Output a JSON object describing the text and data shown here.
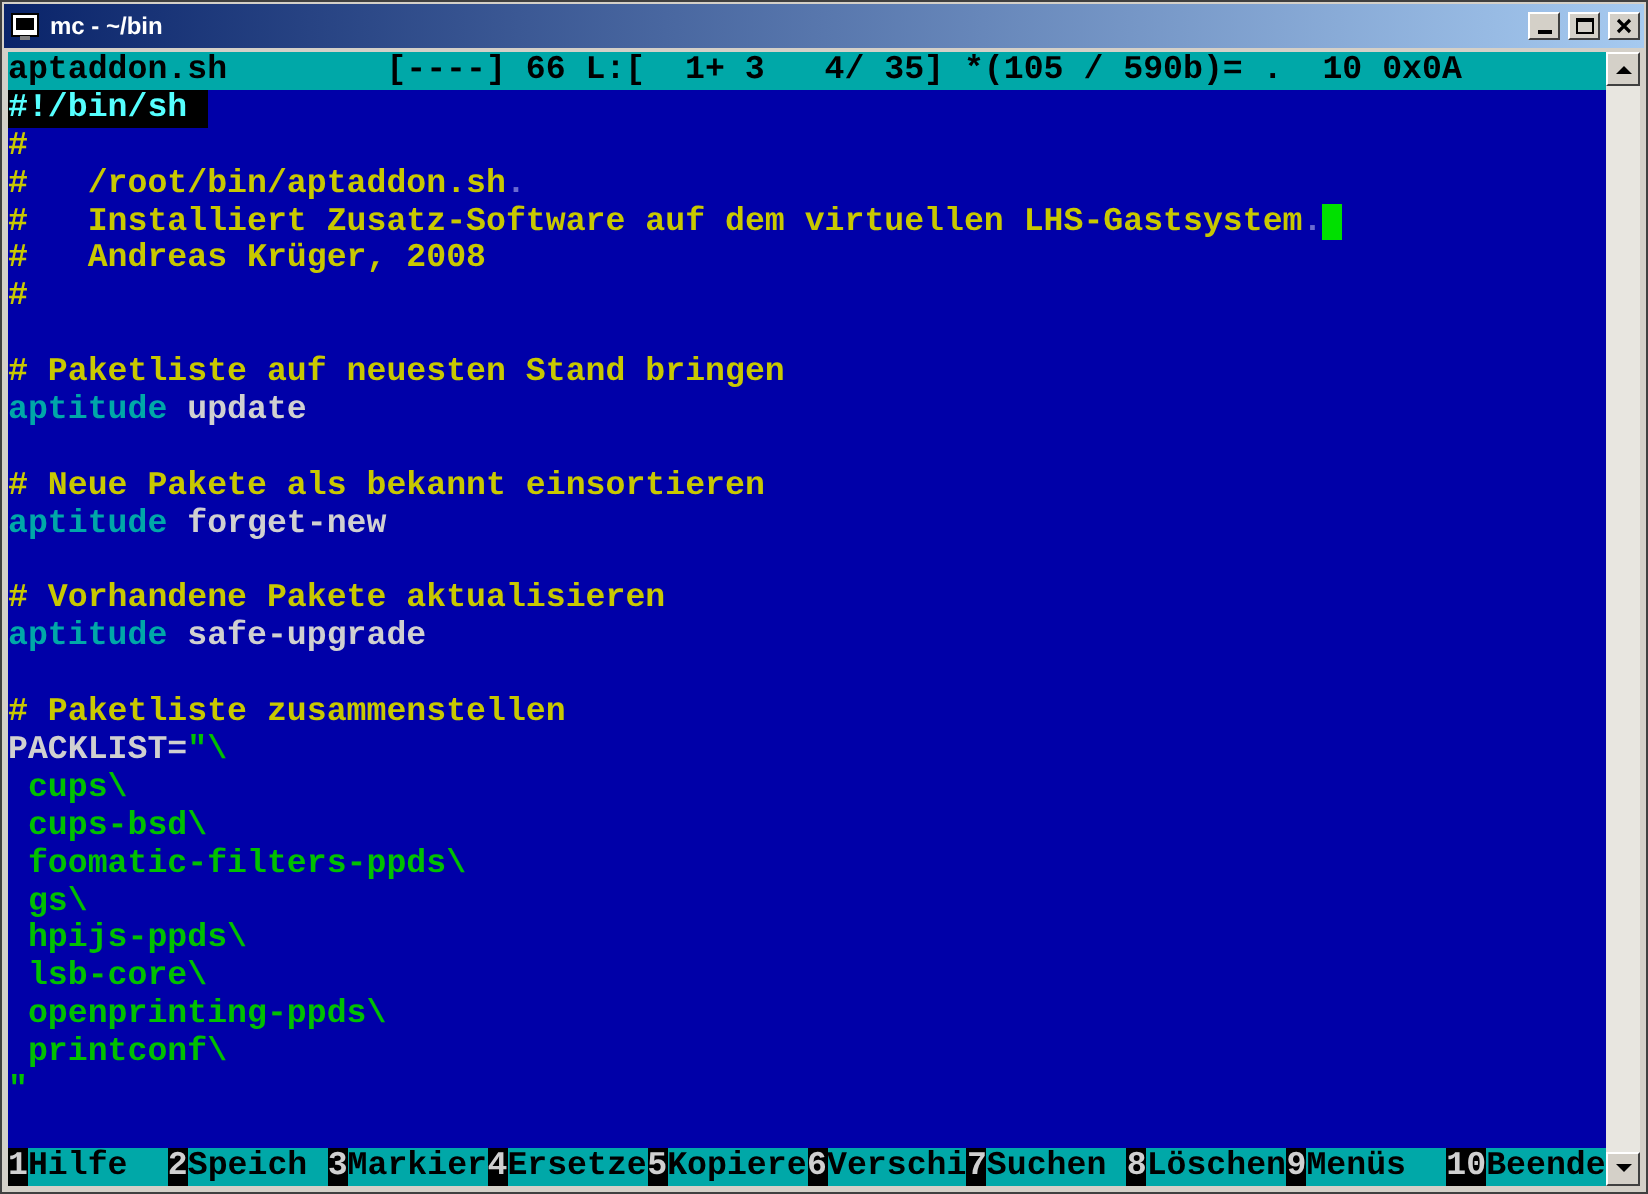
{
  "window": {
    "title": "mc - ~/bin"
  },
  "status_bar": {
    "filename": "aptaddon.sh",
    "info": "[----] 66 L:[  1+ 3   4/ 35] *(105 / 590b)= .  10 0x0A"
  },
  "blocks": [
    {
      "lines": [
        {
          "segments": [
            {
              "kind": "shebang",
              "text": "#!/bin/sh "
            }
          ]
        },
        {
          "segments": [
            {
              "kind": "comment",
              "text": "#"
            }
          ]
        },
        {
          "segments": [
            {
              "kind": "comment",
              "text": "#   /root/bin/aptaddon.sh"
            },
            {
              "kind": "marker",
              "text": "."
            }
          ]
        },
        {
          "segments": [
            {
              "kind": "comment",
              "text": "#   Installiert Zusatz-Software auf dem virtuellen LHS-Gastsystem"
            },
            {
              "kind": "marker",
              "text": "."
            },
            {
              "kind": "cursor"
            }
          ]
        },
        {
          "segments": [
            {
              "kind": "comment",
              "text": "#   Andreas Krüger, 2008"
            }
          ]
        },
        {
          "segments": [
            {
              "kind": "comment",
              "text": "#"
            }
          ]
        }
      ]
    },
    {
      "lines": [
        {
          "segments": [
            {
              "kind": "comment",
              "text": "# Paketliste auf neuesten Stand bringen"
            }
          ]
        },
        {
          "segments": [
            {
              "kind": "keyword",
              "text": "aptitude"
            },
            {
              "kind": "plain",
              "text": " update"
            }
          ]
        }
      ]
    },
    {
      "lines": [
        {
          "segments": [
            {
              "kind": "comment",
              "text": "# Neue Pakete als bekannt einsortieren"
            }
          ]
        },
        {
          "segments": [
            {
              "kind": "keyword",
              "text": "aptitude"
            },
            {
              "kind": "plain",
              "text": " forget-new"
            }
          ]
        }
      ]
    },
    {
      "lines": [
        {
          "segments": [
            {
              "kind": "comment",
              "text": "# Vorhandene Pakete aktualisieren"
            }
          ]
        },
        {
          "segments": [
            {
              "kind": "keyword",
              "text": "aptitude"
            },
            {
              "kind": "plain",
              "text": " safe-upgrade"
            }
          ]
        }
      ]
    },
    {
      "lines": [
        {
          "segments": [
            {
              "kind": "comment",
              "text": "# Paketliste zusammenstellen"
            }
          ]
        },
        {
          "segments": [
            {
              "kind": "plain",
              "text": "PACKLIST="
            },
            {
              "kind": "string",
              "text": "\"\\"
            }
          ]
        },
        {
          "segments": [
            {
              "kind": "string",
              "text": " cups\\"
            }
          ]
        },
        {
          "segments": [
            {
              "kind": "string",
              "text": " cups-bsd\\"
            }
          ]
        },
        {
          "segments": [
            {
              "kind": "string",
              "text": " foomatic-filters-ppds\\"
            }
          ]
        },
        {
          "segments": [
            {
              "kind": "string",
              "text": " gs\\"
            }
          ]
        },
        {
          "segments": [
            {
              "kind": "string",
              "text": " hpijs-ppds\\"
            }
          ]
        },
        {
          "segments": [
            {
              "kind": "string",
              "text": " lsb-core\\"
            }
          ]
        },
        {
          "segments": [
            {
              "kind": "string",
              "text": " openprinting-ppds\\"
            }
          ]
        },
        {
          "segments": [
            {
              "kind": "string",
              "text": " printconf\\"
            }
          ]
        },
        {
          "segments": [
            {
              "kind": "string",
              "text": "\""
            }
          ]
        }
      ]
    }
  ],
  "function_keys": [
    {
      "number": "1",
      "label": "Hilfe"
    },
    {
      "number": "2",
      "label": "Speich"
    },
    {
      "number": "3",
      "label": "Markier"
    },
    {
      "number": "4",
      "label": "Ersetze"
    },
    {
      "number": "5",
      "label": "Kopiere"
    },
    {
      "number": "6",
      "label": "Verschi"
    },
    {
      "number": "7",
      "label": "Suchen"
    },
    {
      "number": "8",
      "label": "Löschen"
    },
    {
      "number": "9",
      "label": "Menüs"
    },
    {
      "number": "10",
      "label": "Beende"
    }
  ]
}
